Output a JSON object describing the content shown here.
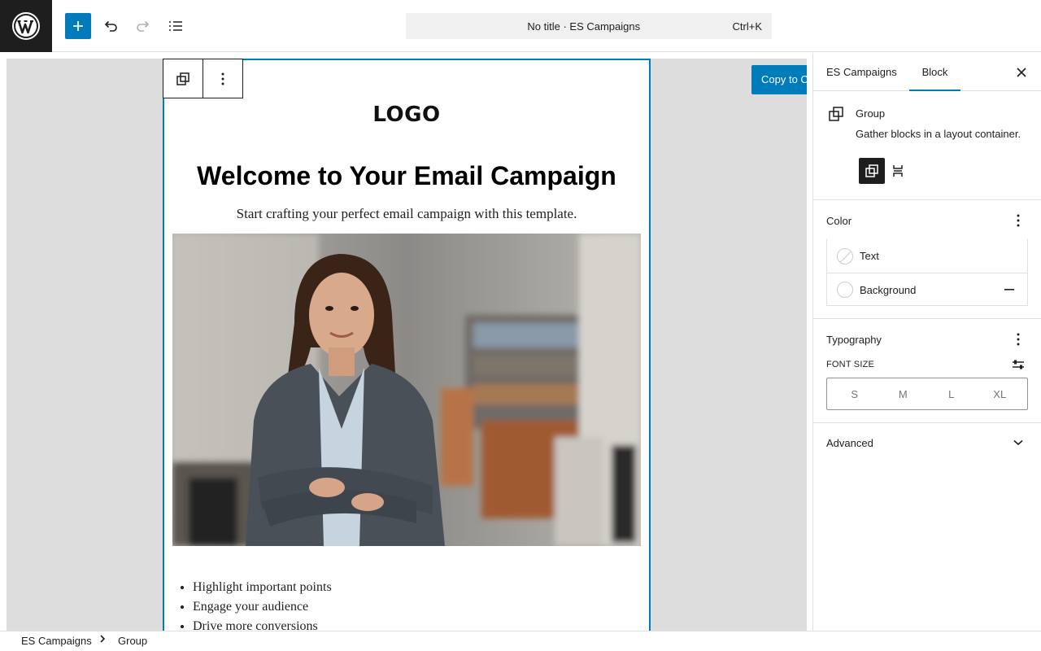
{
  "topbar": {
    "logo_icon": "wordpress-logo-icon",
    "add_icon": "plus-icon",
    "undo_icon": "undo-icon",
    "redo_icon": "redo-icon",
    "outline_icon": "document-overview-icon",
    "command_title": "No title · ES Campaigns",
    "command_shortcut": "Ctrl+K"
  },
  "canvas": {
    "toolbar_icons": [
      "group-icon",
      "kebab-icon"
    ],
    "copy_button": "Copy to Ca",
    "email": {
      "logo": "LOGO",
      "headline": "Welcome to Your Email Campaign",
      "subline": "Start crafting your perfect email campaign with this template.",
      "image_description": "photo-of-businesswoman-in-office",
      "bullets": [
        "Highlight important points",
        "Engage your audience",
        "Drive more conversions"
      ]
    }
  },
  "sidebar": {
    "tabs": [
      "ES Campaigns",
      "Block"
    ],
    "active_tab": "Block",
    "block": {
      "name": "Group",
      "description": "Gather blocks in a layout container."
    },
    "color": {
      "title": "Color",
      "items": [
        "Text",
        "Background"
      ]
    },
    "typography": {
      "title": "Typography",
      "font_size_label": "FONT SIZE",
      "sizes": [
        "S",
        "M",
        "L",
        "XL"
      ]
    },
    "advanced": {
      "title": "Advanced"
    }
  },
  "footer": {
    "breadcrumbs": [
      "ES Campaigns",
      "Group"
    ]
  },
  "colors": {
    "accent": "#007cba",
    "dark": "#1e1e1e",
    "canvas_bg": "#dddddd"
  }
}
